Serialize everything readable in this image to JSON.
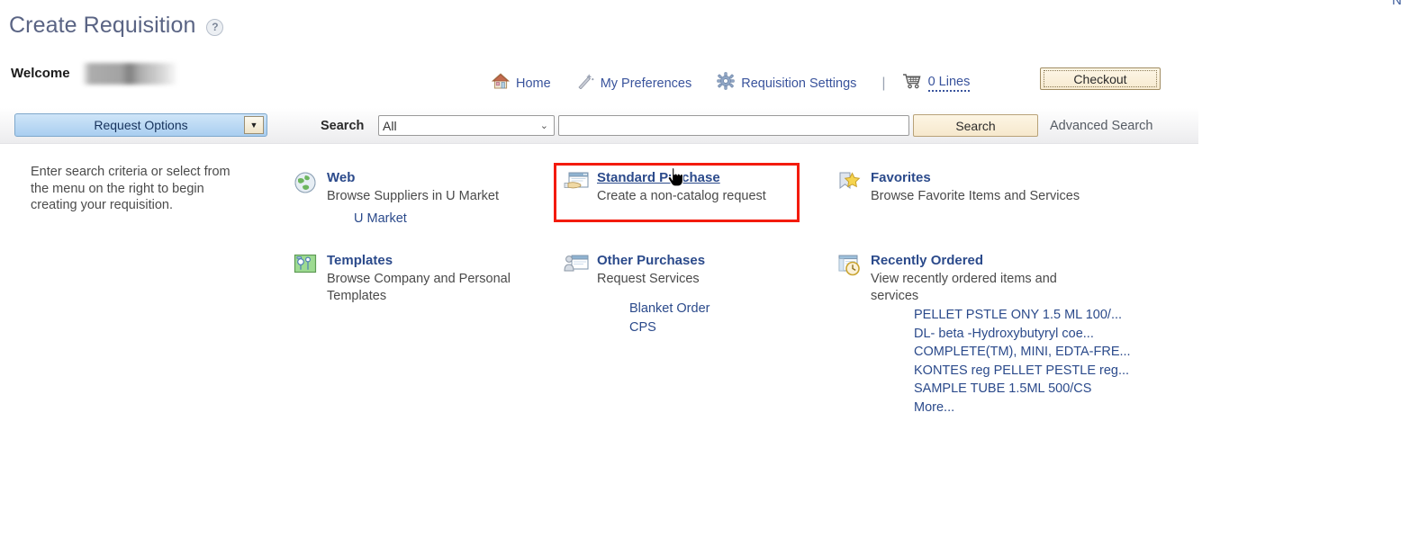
{
  "window": {
    "corner_fragment": "N"
  },
  "header": {
    "page_title": "Create Requisition",
    "help_icon": "help-circle-icon",
    "welcome_label": "Welcome",
    "welcome_user": ""
  },
  "nav": {
    "items": [
      {
        "label": "Home",
        "icon": "home-icon"
      },
      {
        "label": "My Preferences",
        "icon": "magic-wand-icon"
      },
      {
        "label": "Requisition Settings",
        "icon": "gear-icon"
      }
    ],
    "separator": "|",
    "cart": {
      "icon": "shopping-cart-icon",
      "label": "0 Lines"
    },
    "checkout_label": "Checkout"
  },
  "toolbar": {
    "request_options_label": "Request Options",
    "request_options_caret": "▼",
    "search_label": "Search",
    "search_scope_value": "All",
    "search_scope_caret": "⌄",
    "search_input_value": "",
    "search_input_placeholder": "",
    "search_button_label": "Search",
    "advanced_search_label": "Advanced Search"
  },
  "left_panel": {
    "instructions": "Enter search criteria or select from the menu on the right to begin creating your requisition."
  },
  "tiles": [
    {
      "id": "web",
      "icon": "globe-icon",
      "title": "Web",
      "description": "Browse Suppliers in U Market",
      "sublinks": [
        "U Market"
      ]
    },
    {
      "id": "standard-purchase",
      "icon": "window-hand-icon",
      "title": "Standard Purchase",
      "description": "Create a non-catalog request",
      "sublinks": [],
      "highlighted": true
    },
    {
      "id": "favorites",
      "icon": "bookmark-star-icon",
      "title": "Favorites",
      "description": "Browse Favorite Items and Services",
      "sublinks": []
    },
    {
      "id": "templates",
      "icon": "templates-icon",
      "title": "Templates",
      "description": "Browse Company and Personal Templates",
      "sublinks": []
    },
    {
      "id": "other-purchases",
      "icon": "person-window-icon",
      "title": "Other Purchases",
      "description": "Request Services",
      "sublinks": [
        "Blanket Order",
        "CPS"
      ]
    },
    {
      "id": "recently-ordered",
      "icon": "clock-window-icon",
      "title": "Recently Ordered",
      "description": "View recently ordered items and services",
      "sublinks": [
        "PELLET PSTLE ONY 1.5 ML 100/...",
        "DL- beta -Hydroxybutyryl coe...",
        "COMPLETE(TM), MINI, EDTA-FRE...",
        "KONTES reg PELLET PESTLE reg...",
        "SAMPLE TUBE 1.5ML 500/CS",
        "More..."
      ]
    }
  ],
  "colors": {
    "link_blue": "#2b4a8b",
    "nav_blue": "#39539c",
    "title_gray": "#5a6484",
    "highlight_red": "#f31b0d",
    "button_tan": "#f6e8cd",
    "request_options_blue": "#a9cef0"
  }
}
